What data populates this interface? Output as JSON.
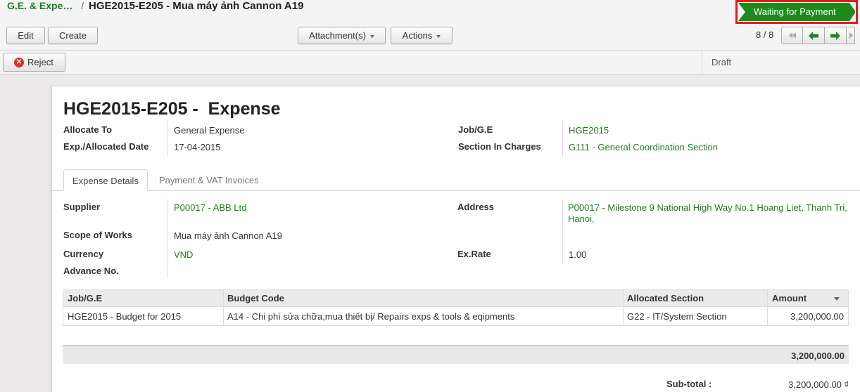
{
  "breadcrumb": {
    "parent": "G.E. & Expe…",
    "separator": "/",
    "current": "HGE2015-E205 - Mua máy ảnh Cannon A19"
  },
  "toolbar": {
    "edit_label": "Edit",
    "create_label": "Create",
    "attachments_label": "Attachment(s)",
    "actions_label": "Actions"
  },
  "pager": {
    "count": "8 / 8"
  },
  "statusbar": {
    "reject_label": "Reject",
    "stages": [
      "Draft",
      "Waiting for Payment"
    ],
    "active_stage": "Waiting for Payment"
  },
  "form": {
    "title": "HGE2015-E205 -  Expense",
    "allocate_to_label": "Allocate To",
    "allocate_to_value": "General Expense",
    "date_label": "Exp./Allocated Date",
    "date_value": "17-04-2015",
    "job_label": "Job/G.E",
    "job_value": "HGE2015",
    "section_label": "Section In Charges",
    "section_value": "G111 - General Coordination Section"
  },
  "tabs": [
    {
      "label": "Expense Details"
    },
    {
      "label": "Payment & VAT Invoices"
    }
  ],
  "details": {
    "supplier_label": "Supplier",
    "supplier_value": "P00017 - ABB Ltd",
    "address_label": "Address",
    "address_line1": "P00017 - Milestone 9 National High Way No.1 Hoang Liet, Thanh Tri,",
    "address_line2": "Hanoi,",
    "scope_label": "Scope of Works",
    "scope_value": "Mua máy ảnh Cannon A19",
    "currency_label": "Currency",
    "currency_value": "VND",
    "exrate_label": "Ex.Rate",
    "exrate_value": "1.00",
    "advance_label": "Advance No."
  },
  "table": {
    "headers": [
      "Job/G.E",
      "Budget Code",
      "Allocated Section",
      "Amount"
    ],
    "rows": [
      [
        "HGE2015 - Budget for 2015",
        "A14 - Chi phí sửa chữa,mua thiết bị/ Repairs exps & tools & eqipments",
        "G22 - IT/System Section",
        "3,200,000.00"
      ]
    ],
    "total": "3,200,000.00"
  },
  "summary": {
    "subtotal_label": "Sub-total :",
    "subtotal_value": "3,200,000.00 ₫"
  },
  "colors": {
    "link_green": "#1f7d1f",
    "stage_active": "#1d8a1d",
    "highlight_red": "#e21b1b"
  }
}
